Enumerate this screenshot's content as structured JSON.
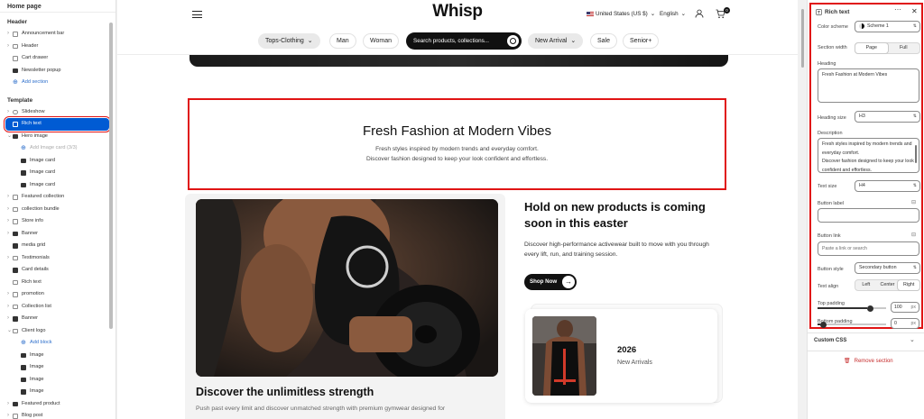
{
  "left_panel": {
    "title": "Home page",
    "header_section": "Header",
    "header_items": [
      {
        "label": "Announcement bar",
        "icon": "section-icon",
        "chevron": true
      },
      {
        "label": "Header",
        "icon": "section-icon",
        "chevron": true
      },
      {
        "label": "Cart drawer",
        "icon": "section-icon",
        "chevron": false
      },
      {
        "label": "Newsletter popup",
        "icon": "image-section-icon",
        "chevron": false
      },
      {
        "label": "Add section",
        "icon": "plus-circle-icon",
        "add": true
      }
    ],
    "template_section": "Template",
    "template_items": [
      {
        "label": "Slideshow",
        "icon": "slideshow-icon",
        "chevron": true,
        "indent": 0
      },
      {
        "label": "Rich text",
        "icon": "text-section-icon",
        "chevron": false,
        "indent": 0,
        "selected": true
      },
      {
        "label": "Hero image",
        "icon": "image-section-icon",
        "chevron": true,
        "open": true,
        "indent": 0
      },
      {
        "label": "Add Image card (3/3)",
        "icon": "plus-circle-icon",
        "indent": 1,
        "disabled": true
      },
      {
        "label": "Image card",
        "icon": "image-block-icon",
        "indent": 1
      },
      {
        "label": "Image card",
        "icon": "image-block-icon",
        "indent": 1
      },
      {
        "label": "Image card",
        "icon": "image-block-icon",
        "indent": 1
      },
      {
        "label": "Featured collection",
        "icon": "section-icon",
        "chevron": true,
        "indent": 0
      },
      {
        "label": "collection bundle",
        "icon": "section-icon",
        "chevron": true,
        "indent": 0
      },
      {
        "label": "Store info",
        "icon": "section-icon",
        "chevron": true,
        "indent": 0
      },
      {
        "label": "Banner",
        "icon": "image-section-icon",
        "chevron": true,
        "indent": 0
      },
      {
        "label": "media grid",
        "icon": "image-section-icon",
        "chevron": false,
        "indent": 0
      },
      {
        "label": "Testimonials",
        "icon": "section-icon",
        "chevron": true,
        "indent": 0
      },
      {
        "label": "Card details",
        "icon": "image-section-icon",
        "chevron": false,
        "indent": 0
      },
      {
        "label": "Rich text",
        "icon": "text-section-icon",
        "chevron": false,
        "indent": 0
      },
      {
        "label": "promotion",
        "icon": "section-icon",
        "chevron": true,
        "indent": 0
      },
      {
        "label": "Collection list",
        "icon": "section-icon",
        "chevron": true,
        "indent": 0
      },
      {
        "label": "Banner",
        "icon": "image-section-icon",
        "chevron": true,
        "indent": 0
      },
      {
        "label": "Client logo",
        "icon": "section-icon",
        "chevron": true,
        "open": true,
        "indent": 0
      },
      {
        "label": "Add block",
        "icon": "plus-circle-icon",
        "indent": 1,
        "add": true
      },
      {
        "label": "Image",
        "icon": "image-block-icon",
        "indent": 1
      },
      {
        "label": "Image",
        "icon": "image-block-icon",
        "indent": 1
      },
      {
        "label": "Image",
        "icon": "image-block-icon",
        "indent": 1
      },
      {
        "label": "Image",
        "icon": "image-block-icon",
        "indent": 1
      },
      {
        "label": "Featured product",
        "icon": "product-icon",
        "chevron": true,
        "indent": 0
      },
      {
        "label": "Blog post",
        "icon": "section-icon",
        "chevron": true,
        "indent": 0
      }
    ]
  },
  "preview": {
    "logo": "Whisp",
    "country": "United States (US $)",
    "language": "English",
    "cart_count": "0",
    "nav": [
      {
        "label": "Tops-Clothing",
        "gray": true,
        "caret": true
      },
      {
        "label": "Man"
      },
      {
        "label": "Woman"
      },
      {
        "label": "New Arrival",
        "gray": true,
        "caret": true
      },
      {
        "label": "Sale"
      },
      {
        "label": "Senior+"
      }
    ],
    "search_placeholder": "Search products, collections...",
    "rich_text": {
      "heading": "Fresh Fashion at Modern Vibes",
      "line1": "Fresh styles inspired by modern trends and everyday comfort.",
      "line2": "Discover fashion designed to keep your look confident and effortless."
    },
    "card_left": {
      "title": "Discover the unlimitless strength",
      "text": "Push past every limit and discover unmatched strength with premium gymwear designed for"
    },
    "card_right": {
      "title": "Hold on new products is coming soon in this easter",
      "text": "Discover high-performance activewear built to move with you through every lift, run, and training session.",
      "button": "Shop Now",
      "year": "2026",
      "subtitle": "New Arrivals"
    }
  },
  "right_panel": {
    "title": "Rich text",
    "color_scheme_label": "Color scheme",
    "color_scheme_value": "Scheme 1",
    "section_width_label": "Section width",
    "section_width_options": [
      "Page",
      "Full"
    ],
    "section_width_selected": "Page",
    "heading_label": "Heading",
    "heading_value": "Fresh Fashion at Modern Vibes",
    "heading_size_label": "Heading size",
    "heading_size_value": "H3",
    "description_label": "Description",
    "description_value": "Fresh styles inspired by modern trends and everyday comfort.\nDiscover fashion designed to keep your look confident and effortless.",
    "text_size_label": "Text size",
    "text_size_value": "H4",
    "button_label_label": "Button label",
    "button_label_value": "",
    "button_link_label": "Button link",
    "button_link_placeholder": "Paste a link or search",
    "button_style_label": "Button style",
    "button_style_value": "Secondary button",
    "text_align_label": "Text align",
    "text_align_options": [
      "Left",
      "Center",
      "Right"
    ],
    "text_align_selected": "Right",
    "top_padding_label": "Top padding",
    "top_padding_value": "100",
    "bottom_padding_label": "Bottom padding",
    "bottom_padding_value": "0",
    "padding_unit": "px",
    "padding_max": 100,
    "custom_css_label": "Custom CSS",
    "remove_label": "Remove section"
  },
  "colors": {
    "selected": "#005bd3",
    "highlight": "#e01414",
    "remove": "#c62c2c",
    "dark": "#111111"
  }
}
